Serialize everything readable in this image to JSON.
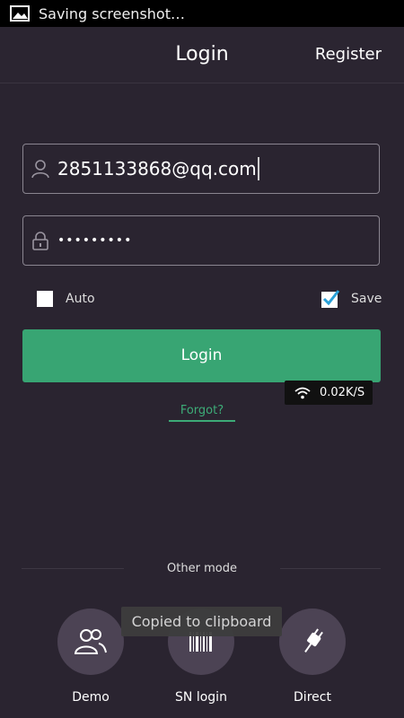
{
  "status_bar": {
    "text": "Saving screenshot…",
    "icon": "image-icon"
  },
  "header": {
    "title": "Login",
    "register_label": "Register"
  },
  "form": {
    "username": {
      "value": "2851133868@qq.com",
      "icon": "user-icon"
    },
    "password": {
      "value": "•••••••••",
      "icon": "lock-icon"
    },
    "auto_label": "Auto",
    "auto_checked": false,
    "save_label": "Save",
    "save_checked": true,
    "login_label": "Login",
    "forgot_label": "Forgot?"
  },
  "network": {
    "speed": "0.02K/S",
    "icon": "wifi-icon"
  },
  "other_modes": {
    "title": "Other mode",
    "items": [
      {
        "label": "Demo",
        "icon": "users-icon"
      },
      {
        "label": "SN login",
        "icon": "barcode-icon"
      },
      {
        "label": "Direct",
        "icon": "plug-icon"
      }
    ]
  },
  "toast": {
    "text": "Copied to clipboard"
  },
  "colors": {
    "accent": "#38a573",
    "background": "#2a2430",
    "circle": "#4c4354"
  }
}
